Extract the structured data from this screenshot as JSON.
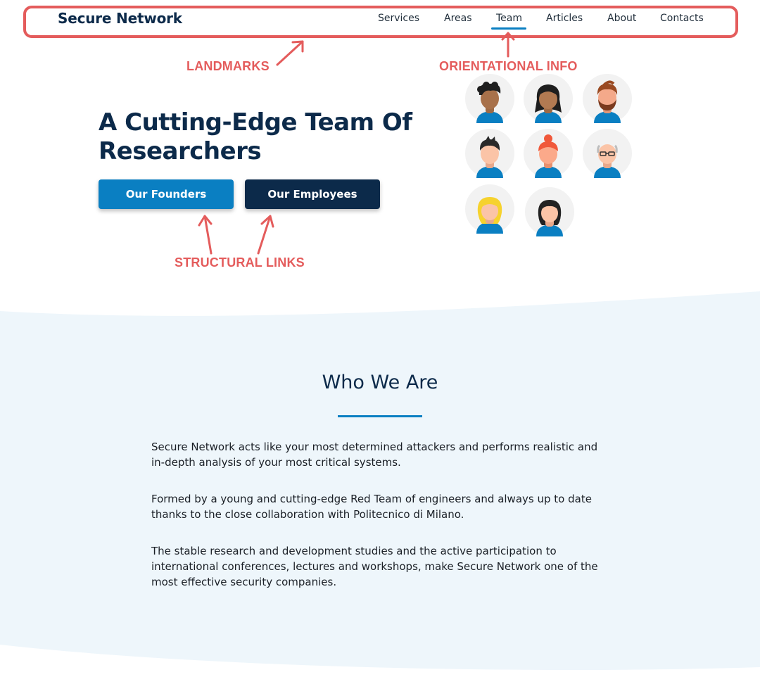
{
  "header": {
    "logo": "Secure Network",
    "nav": [
      {
        "label": "Services"
      },
      {
        "label": "Areas"
      },
      {
        "label": "Team",
        "active": true
      },
      {
        "label": "Articles"
      },
      {
        "label": "About"
      },
      {
        "label": "Contacts"
      }
    ]
  },
  "hero": {
    "title": "A Cutting-Edge Team Of Researchers",
    "buttons": {
      "founders": "Our Founders",
      "employees": "Our Employees"
    }
  },
  "annotations": {
    "landmarks": "LANDMARKS",
    "orientational": "ORIENTATIONAL INFO",
    "structural": "STRUCTURAL LINKS"
  },
  "who_we_are": {
    "title": "Who We Are",
    "paragraphs": [
      "Secure Network acts like your most determined attackers and performs realistic and in-depth analysis of your most critical systems.",
      "Formed by a young and cutting-edge Red Team of engineers and always up to date thanks to the close collaboration with Politecnico di Milano.",
      "The stable research and development studies and the active participation to international conferences, lectures and workshops, make Secure Network one of the most effective security companies."
    ]
  },
  "colors": {
    "brand_dark": "#0c2a4a",
    "brand_blue": "#0a7fc2",
    "annotation_red": "#e45c5c",
    "section_bg": "#eef6fb"
  }
}
